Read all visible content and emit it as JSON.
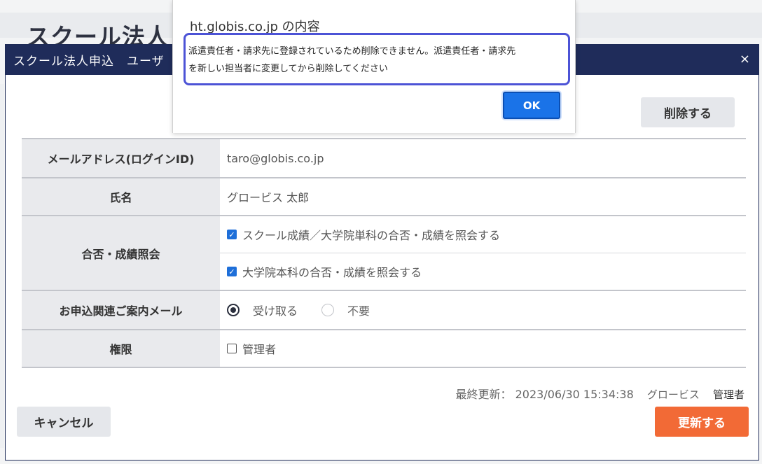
{
  "background": {
    "title": "スクール法人"
  },
  "modal": {
    "title": "スクール法人申込　ユーザ",
    "close_icon": "×",
    "delete_label": "削除する",
    "rows": {
      "mail": {
        "label": "メールアドレス(ログインID)",
        "value": "taro@globis.co.jp"
      },
      "name": {
        "label": "氏名",
        "value": "グロービス 太郎"
      },
      "pass": {
        "label": "合否・成績照会",
        "options": [
          {
            "label": "スクール成績／大学院単科の合否・成績を照会する",
            "checked": true
          },
          {
            "label": "大学院本科の合否・成績を照会する",
            "checked": true
          }
        ]
      },
      "mailpref": {
        "label": "お申込関連ご案内メール",
        "options": [
          "受け取る",
          "不要"
        ],
        "selected": "受け取る"
      },
      "auth": {
        "label": "権限",
        "option": "管理者",
        "checked": false
      }
    },
    "last_update": {
      "prefix": "最終更新：",
      "datetime": "2023/06/30 15:34:38",
      "user": "グロービス",
      "role": "管理者"
    },
    "cancel_label": "キャンセル",
    "update_label": "更新する"
  },
  "dialog": {
    "origin": "ht.globis.co.jp の内容",
    "message_line1": "派遣責任者・請求先に登録されているため削除できません。派遣責任者・請求先",
    "message_line2": "を新しい担当者に変更してから削除してください",
    "ok_label": "OK"
  },
  "colors": {
    "header": "#1f2c5a",
    "update_button": "#f26a36",
    "ok_button": "#1a73e8",
    "focus_ring": "#4c53d6"
  }
}
